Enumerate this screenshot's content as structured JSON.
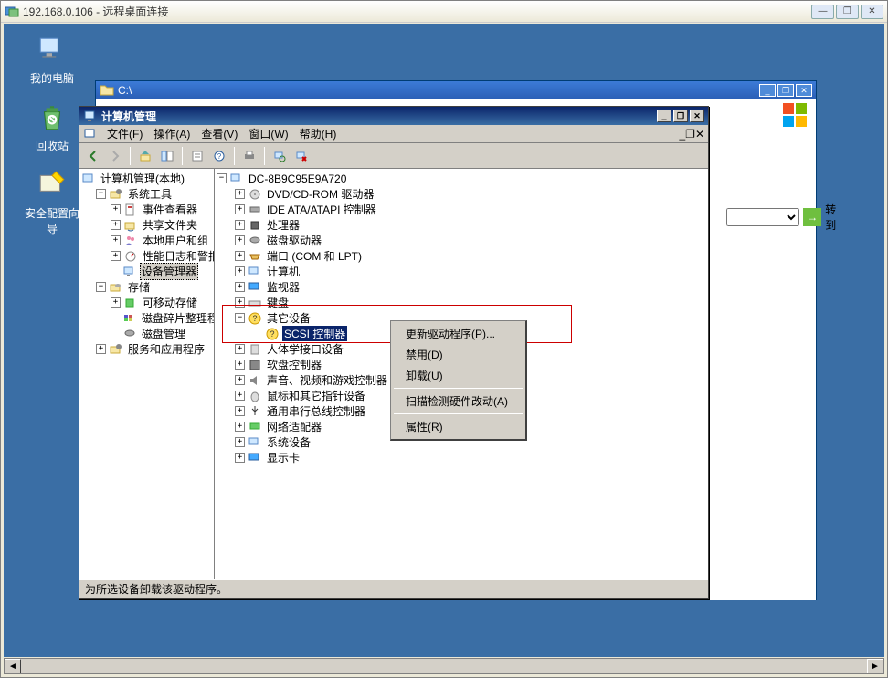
{
  "rdp": {
    "title": "192.168.0.106 - 远程桌面连接",
    "min": "—",
    "max": "❐",
    "close": "✕"
  },
  "desktop": {
    "mycomputer": "我的电脑",
    "recyclebin": "回收站",
    "securitywiz": "安全配置向导"
  },
  "explorer": {
    "title": "C:\\",
    "go": "转到",
    "arrow": "→"
  },
  "mmc": {
    "title": "计算机管理",
    "menu": {
      "file": "文件(F)",
      "action": "操作(A)",
      "view": "查看(V)",
      "window": "窗口(W)",
      "help": "帮助(H)"
    },
    "left": {
      "root": "计算机管理(本地)",
      "systools": "系统工具",
      "evtviewer": "事件查看器",
      "sharedfolders": "共享文件夹",
      "localusers": "本地用户和组",
      "perflogs": "性能日志和警报",
      "devmgr": "设备管理器",
      "storage": "存储",
      "removable": "可移动存储",
      "defrag": "磁盘碎片整理程序",
      "diskmgmt": "磁盘管理",
      "services": "服务和应用程序"
    },
    "dev": {
      "host": "DC-8B9C95E9A720",
      "dvd": "DVD/CD-ROM 驱动器",
      "ide": "IDE ATA/ATAPI 控制器",
      "cpu": "处理器",
      "diskdrives": "磁盘驱动器",
      "ports": "端口 (COM 和 LPT)",
      "computer": "计算机",
      "monitor": "监视器",
      "keyboard": "键盘",
      "other": "其它设备",
      "scsi": "SCSI 控制器",
      "hid": "人体学接口设备",
      "floppy": "软盘控制器",
      "sound": "声音、视频和游戏控制器",
      "mouse": "鼠标和其它指针设备",
      "usb": "通用串行总线控制器",
      "network": "网络适配器",
      "sysdev": "系统设备",
      "display": "显示卡"
    },
    "status": "为所选设备卸载该驱动程序。"
  },
  "ctx": {
    "update": "更新驱动程序(P)...",
    "disable": "禁用(D)",
    "uninstall": "卸载(U)",
    "scan": "扫描检测硬件改动(A)",
    "properties": "属性(R)"
  },
  "exp": {
    "plus": "+",
    "minus": "−"
  }
}
